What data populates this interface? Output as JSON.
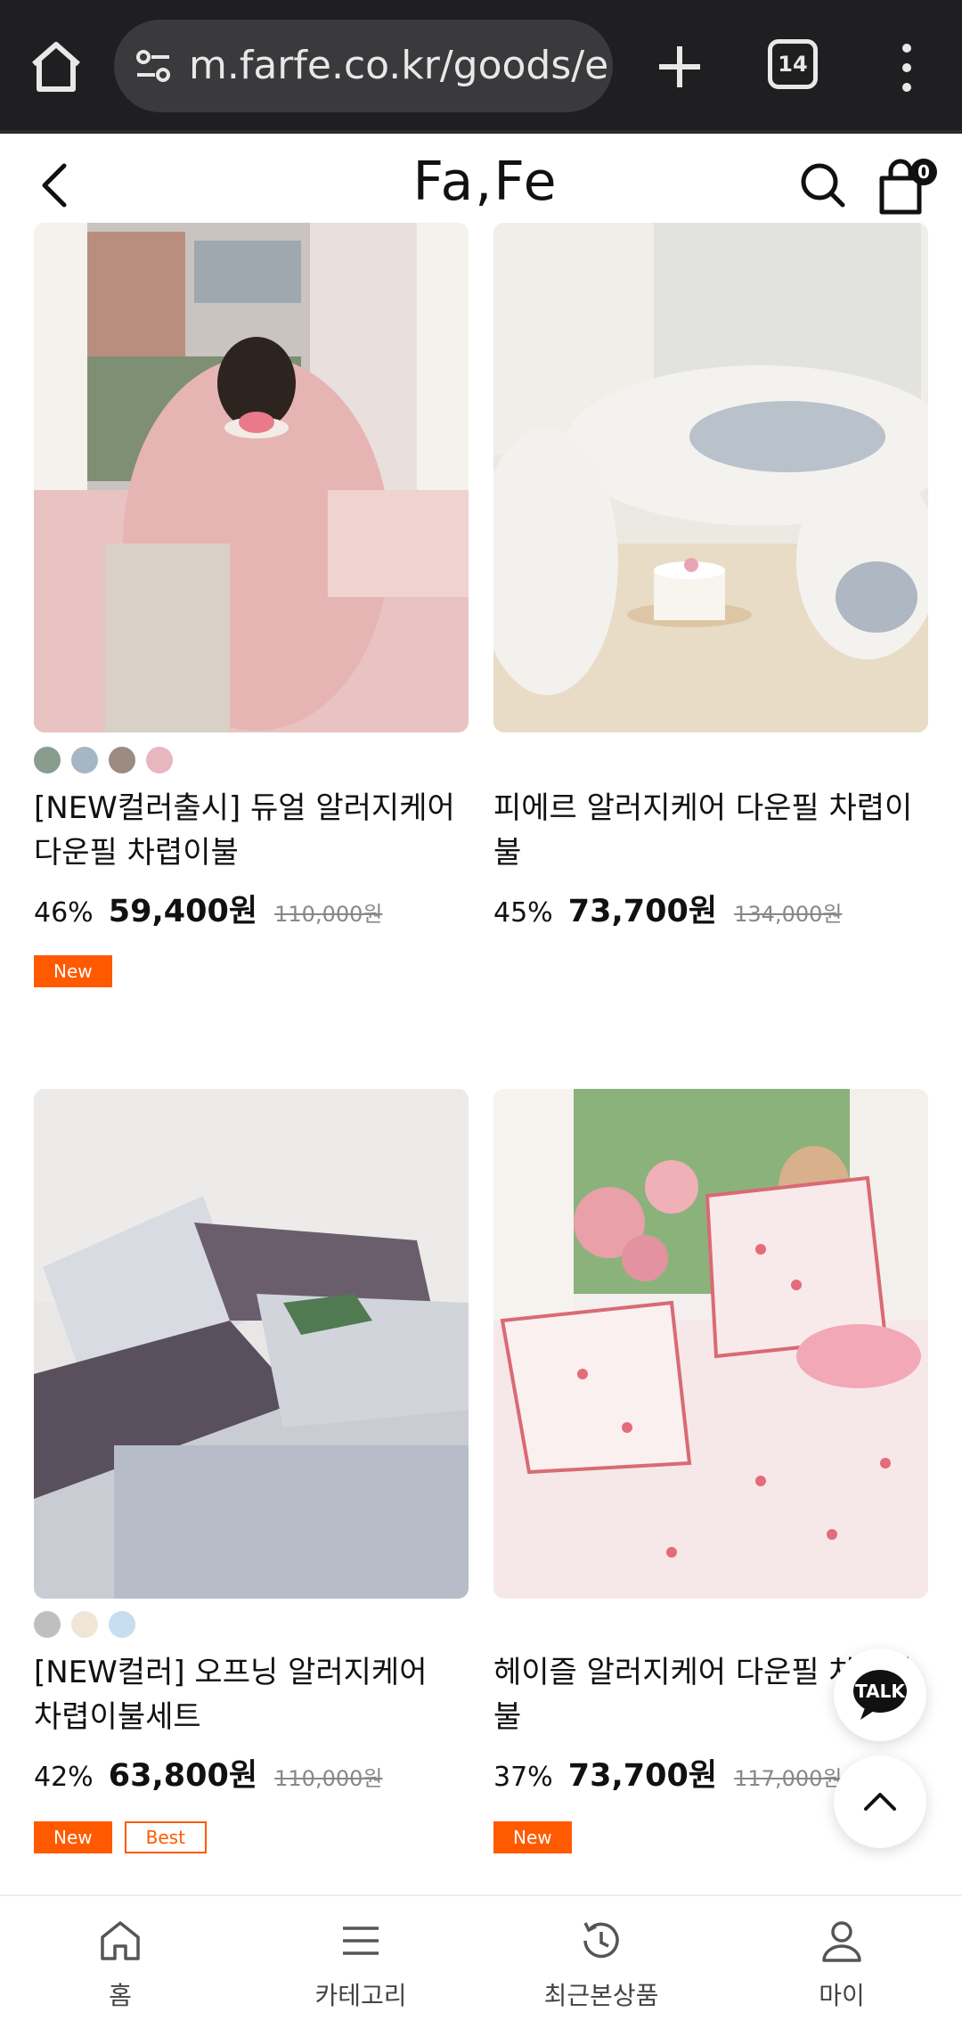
{
  "browser": {
    "url": "m.farfe.co.kr/goods/e",
    "tab_count": "14"
  },
  "header": {
    "logo": "Fa,Fe",
    "cart_count": "0"
  },
  "products": [
    {
      "name": "[NEW컬러출시] 듀얼 알러지케어 다운필 차렵이불",
      "discount": "46%",
      "price": "59,400원",
      "original_price": "110,000원",
      "swatches": [
        "#8a9c8e",
        "#a7b6c4",
        "#9b8b80",
        "#e8b6be"
      ],
      "badges": [
        "New"
      ]
    },
    {
      "name": "피에르 알러지케어 다운필 차렵이불",
      "discount": "45%",
      "price": "73,700원",
      "original_price": "134,000원",
      "swatches": [],
      "badges": []
    },
    {
      "name": "[NEW컬러] 오프닝 알러지케어 차렵이불세트",
      "discount": "42%",
      "price": "63,800원",
      "original_price": "110,000원",
      "swatches": [
        "#bfbfbf",
        "#efe6d8",
        "#c6def0"
      ],
      "badges": [
        "New",
        "Best"
      ]
    },
    {
      "name": "헤이즐 알러지케어 다운필 차렵이불",
      "discount": "37%",
      "price": "73,700원",
      "original_price": "117,000원",
      "swatches": [],
      "badges": [
        "New"
      ]
    }
  ],
  "floating": {
    "talk_label": "TALK"
  },
  "bottom_nav": [
    {
      "label": "홈",
      "icon": "home-icon"
    },
    {
      "label": "카테고리",
      "icon": "menu-icon"
    },
    {
      "label": "최근본상품",
      "icon": "history-icon"
    },
    {
      "label": "마이",
      "icon": "user-icon"
    }
  ],
  "colors": {
    "accent": "#ff5a00",
    "browser_bg": "#1f1f22"
  }
}
